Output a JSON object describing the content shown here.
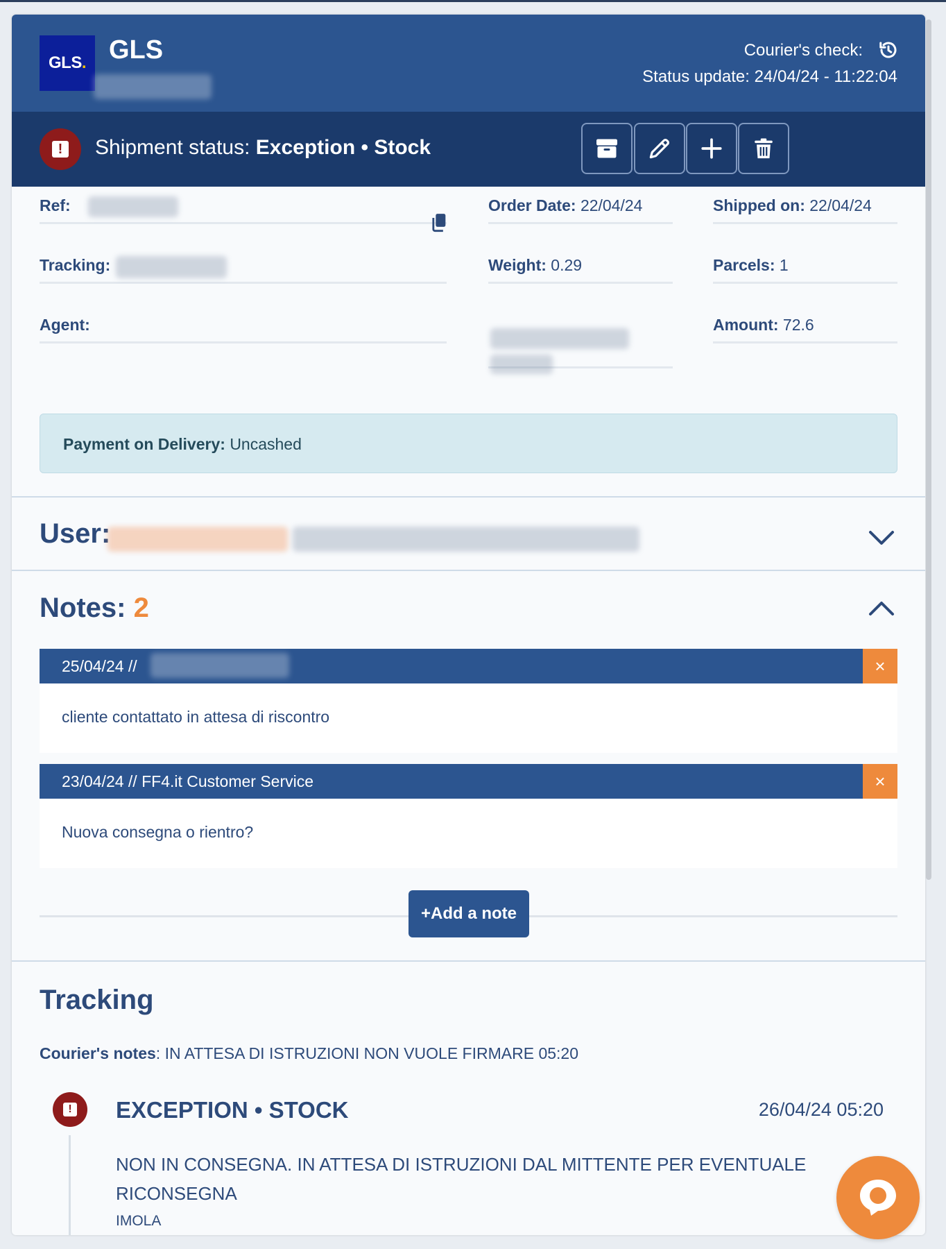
{
  "header": {
    "logo_text": "GLS",
    "logo_dot": ".",
    "courier_name": "GLS",
    "courier_check_label": "Courier's check:",
    "status_update": "Status update: 24/04/24 - 11:22:04"
  },
  "status_bar": {
    "prefix": "Shipment status:",
    "status": "Exception • Stock",
    "buttons": [
      "box-icon",
      "pencil-icon",
      "plus-icon",
      "trash-icon"
    ]
  },
  "details": {
    "ref_label": "Ref:",
    "order_date_label": "Order Date:",
    "order_date_value": "22/04/24",
    "shipped_label": "Shipped on:",
    "shipped_value": "22/04/24",
    "tracking_label": "Tracking:",
    "weight_label": "Weight:",
    "weight_value": "0.29",
    "parcels_label": "Parcels:",
    "parcels_value": "1",
    "agent_label": "Agent:",
    "amount_label": "Amount:",
    "amount_value": "72.6"
  },
  "payment": {
    "label": "Payment on Delivery:",
    "value": "Uncashed"
  },
  "user": {
    "label": "User:"
  },
  "notes": {
    "label": "Notes:",
    "count": "2",
    "items": [
      {
        "header": "25/04/24 //",
        "text": "cliente contattato in attesa di riscontro"
      },
      {
        "header": "23/04/24 // FF4.it Customer Service",
        "text": "Nuova consegna o rientro?"
      }
    ],
    "delete_symbol": "×",
    "add_label": "+Add a note"
  },
  "tracking": {
    "title": "Tracking",
    "courier_notes_label": "Courier's notes",
    "courier_notes_value": ": IN ATTESA DI ISTRUZIONI NON VUOLE FIRMARE 05:20",
    "event": {
      "title": "EXCEPTION • STOCK",
      "date": "26/04/24 05:20",
      "description": "NON IN CONSEGNA. IN ATTESA DI ISTRUZIONI DAL MITTENTE PER EVENTUALE RICONSEGNA",
      "place": "IMOLA"
    }
  },
  "colors": {
    "header_blue": "#2c5590",
    "status_navy": "#1b3a6b",
    "danger_red": "#8e1b1b",
    "accent_orange": "#ee8a3c",
    "text_blue": "#2d4a7a"
  }
}
